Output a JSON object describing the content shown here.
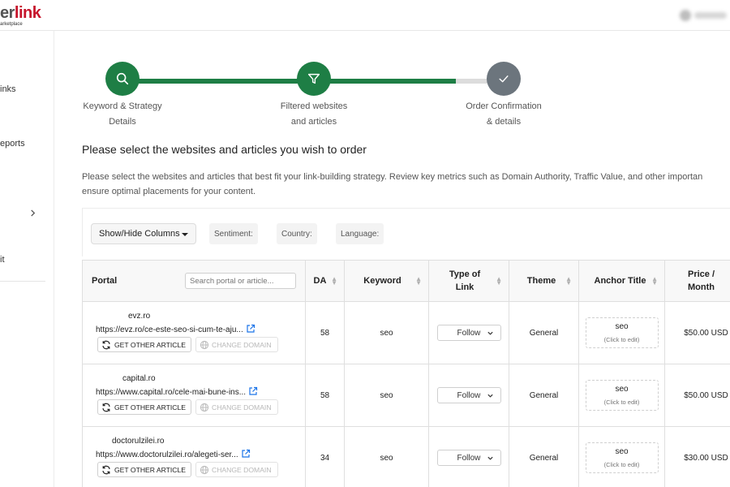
{
  "brand": {
    "logo_part1": "er",
    "logo_part2": "link",
    "logo_sub": "arketplace"
  },
  "sidebar": {
    "items": [
      {
        "label": "inks"
      },
      {
        "label": "eports"
      },
      {
        "label": "it"
      }
    ]
  },
  "stepper": {
    "steps": [
      {
        "line1": "Keyword & Strategy",
        "line2": "Details",
        "icon": "search-icon",
        "state": "done"
      },
      {
        "line1": "Filtered websites",
        "line2": "and articles",
        "icon": "filter-icon",
        "state": "done"
      },
      {
        "line1": "Order Confirmation",
        "line2": "& details",
        "icon": "check-icon",
        "state": "pending"
      }
    ]
  },
  "page": {
    "title": "Please select the websites and articles you wish to order",
    "description_line1": "Please select the websites and articles that best fit your link-building strategy. Review key metrics such as Domain Authority, Traffic Value, and other importan",
    "description_line2": "ensure optimal placements for your content."
  },
  "filters": {
    "columns_button": "Show/Hide Columns",
    "sentiment": "Sentiment:",
    "country": "Country:",
    "language": "Language:"
  },
  "table": {
    "headers": {
      "portal": "Portal",
      "search_placeholder": "Search portal or article...",
      "da": "DA",
      "keyword": "Keyword",
      "type_line1": "Type of",
      "type_line2": "Link",
      "theme": "Theme",
      "anchor": "Anchor Title",
      "price_line1": "Price /",
      "price_line2": "Month"
    },
    "get_other_label": "GET OTHER ARTICLE",
    "change_domain_label": "CHANGE DOMAIN",
    "anchor_hint": "(Click to edit)",
    "rows": [
      {
        "site": "evz.ro",
        "url": "https://evz.ro/ce-este-seo-si-cum-te-aju...",
        "da": "58",
        "keyword": "seo",
        "link_type": "Follow",
        "theme": "General",
        "anchor": "seo",
        "price": "$50.00 USD"
      },
      {
        "site": "capital.ro",
        "url": "https://www.capital.ro/cele-mai-bune-ins...",
        "da": "58",
        "keyword": "seo",
        "link_type": "Follow",
        "theme": "General",
        "anchor": "seo",
        "price": "$50.00 USD"
      },
      {
        "site": "doctorulzilei.ro",
        "url": "https://www.doctorulzilei.ro/alegeti-ser...",
        "da": "34",
        "keyword": "seo",
        "link_type": "Follow",
        "theme": "General",
        "anchor": "seo",
        "price": "$30.00 USD"
      }
    ]
  },
  "colors": {
    "accent": "#1e7e45",
    "price": "#1e8a4c",
    "brand_red": "#c6142b",
    "pending": "#6c757d"
  }
}
